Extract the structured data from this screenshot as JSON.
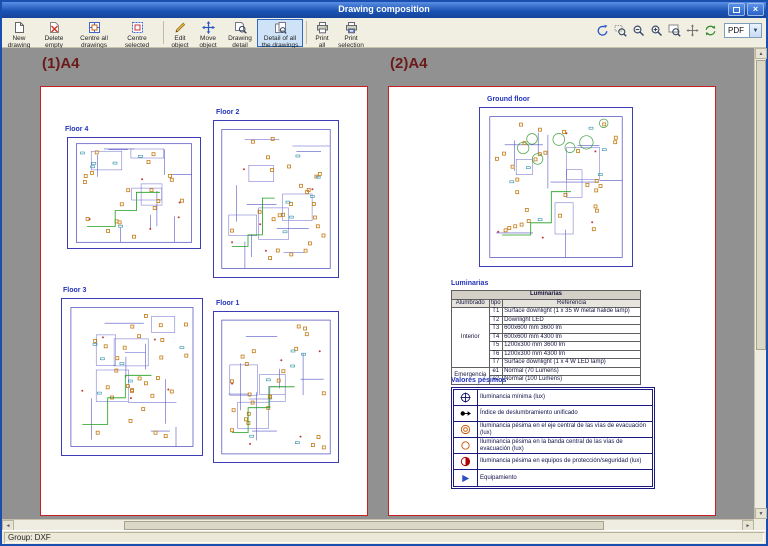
{
  "window": {
    "title": "Drawing composition",
    "controls": [
      "maximize",
      "close"
    ]
  },
  "toolbar": {
    "buttons": [
      {
        "label": "New drawing"
      },
      {
        "label": "Delete empty spaces"
      },
      {
        "label": "Centre all drawings"
      },
      {
        "label": "Centre selected drawings"
      },
      {
        "label": "Edit object"
      },
      {
        "label": "Move object"
      },
      {
        "label": "Drawing detail"
      },
      {
        "label": "Detail of all the drawings",
        "selected": true
      },
      {
        "label": "Print all"
      },
      {
        "label": "Print selection"
      }
    ]
  },
  "view_toolbar": {
    "icons": [
      "redraw",
      "zoom-window",
      "zoom-scale",
      "zoom-in",
      "zoom-all",
      "pan",
      "refresh"
    ],
    "export_format": "PDF"
  },
  "sheets": [
    {
      "label": "(1)A4",
      "plans": [
        {
          "name": "Floor 4"
        },
        {
          "name": "Floor 2"
        },
        {
          "name": "Floor 3"
        },
        {
          "name": "Floor 1"
        }
      ]
    },
    {
      "label": "(2)A4",
      "plans": [
        {
          "name": "Ground floor"
        }
      ],
      "luminaires_table": {
        "section_label": "Luminarias",
        "title": "Luminarias",
        "columns": [
          "Alumbrado",
          "tipo",
          "Referencia"
        ],
        "groups": [
          {
            "name": "Interior",
            "rows": [
              [
                "T1",
                "Surface downlight (1 x 35 W metal halide lamp)"
              ],
              [
                "T2",
                "Downlight LED"
              ],
              [
                "T3",
                "600x600 mm 3600 lm"
              ],
              [
                "T4",
                "600x600 mm 4300 lm"
              ],
              [
                "T5",
                "1200x300 mm 3600 lm"
              ],
              [
                "T6",
                "1200x300 mm 4300 lm"
              ],
              [
                "T7",
                "Surface downlight (1 x 4 W LED lamp)"
              ]
            ]
          },
          {
            "name": "Emergencia",
            "rows": [
              [
                "e1",
                "Normal (70 Lumens)"
              ],
              [
                "e2",
                "Normal (100 Lumens)"
              ]
            ]
          }
        ]
      },
      "legend": {
        "title": "Valores pésimos",
        "items": [
          {
            "icon": "circle-cross",
            "label": "Iluminancia mínima (lux)"
          },
          {
            "icon": "arrow-dot",
            "label": "Índice de deslumbramiento unificado"
          },
          {
            "icon": "double-circle",
            "label": "Iluminancia pésima en el eje central de las vías de evacuación (lux)"
          },
          {
            "icon": "circle",
            "label": "Iluminancia pésima en la banda central de las vías de evacuación (lux)"
          },
          {
            "icon": "half-circle",
            "label": "Iluminancia pésima en equipos de protección/seguridad (lux)"
          },
          {
            "icon": "triangle",
            "label": "Equipamiento"
          }
        ]
      }
    }
  ],
  "status": {
    "text": "Group: DXF"
  },
  "colors": {
    "titlebar": "#1b54b4",
    "sheet_border": "#c22222",
    "plan_blue": "#3c3cb4",
    "selected_button_bg": "#cfe3f8",
    "canvas": "#919191"
  }
}
